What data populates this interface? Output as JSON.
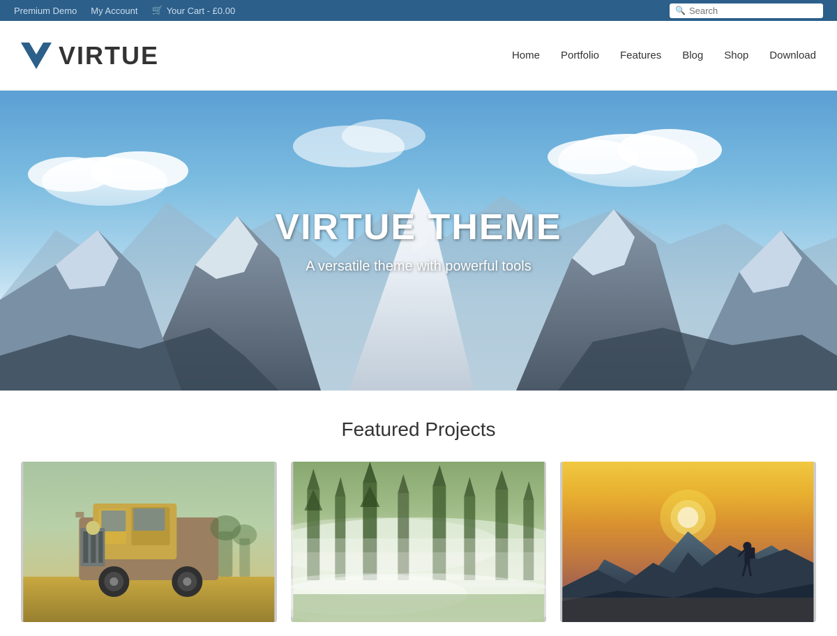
{
  "topbar": {
    "premium_demo": "Premium Demo",
    "my_account": "My Account",
    "cart_icon": "🛒",
    "cart_text": "Your Cart - £0.00",
    "search_placeholder": "Search"
  },
  "header": {
    "logo_text": "VIRTUE",
    "nav": {
      "home": "Home",
      "portfolio": "Portfolio",
      "features": "Features",
      "blog": "Blog",
      "shop": "Shop",
      "download": "Download"
    }
  },
  "hero": {
    "title": "VIRTUE THEME",
    "subtitle": "A versatile theme with powerful tools"
  },
  "featured": {
    "section_title": "Featured Projects",
    "projects": [
      {
        "id": 1,
        "alt": "Old rusty truck in a field"
      },
      {
        "id": 2,
        "alt": "Misty forest with fog"
      },
      {
        "id": 3,
        "alt": "Hiker on mountain at sunset"
      }
    ]
  }
}
